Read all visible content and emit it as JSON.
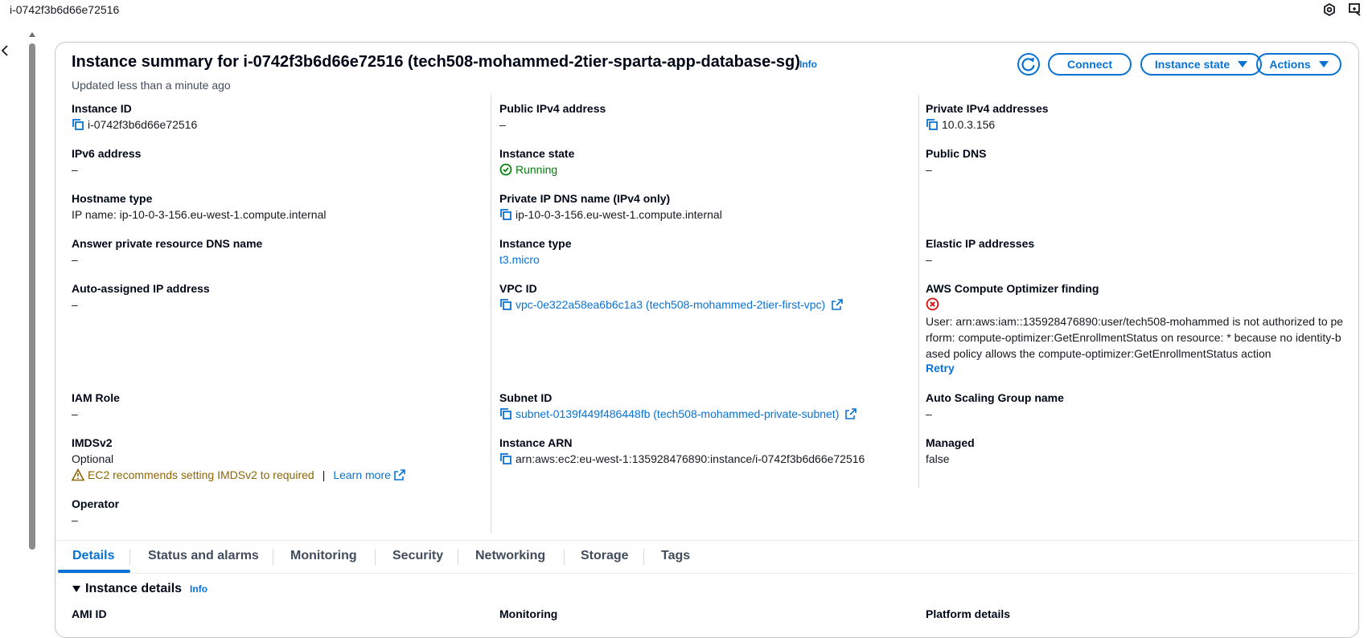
{
  "topbar": {
    "title": "i-0742f3b6d66e72516"
  },
  "summary": {
    "title": "Instance summary for i-0742f3b6d66e72516 (tech508-mohammed-2tier-sparta-app-database-sg)",
    "info": "Info",
    "updated": "Updated less than a minute ago",
    "buttons": {
      "connect": "Connect",
      "instance_state": "Instance state",
      "actions": "Actions"
    }
  },
  "fields": {
    "instance_id": {
      "label": "Instance ID",
      "value": "i-0742f3b6d66e72516"
    },
    "ipv6": {
      "label": "IPv6 address",
      "value": "–"
    },
    "hostname_type": {
      "label": "Hostname type",
      "value": "IP name: ip-10-0-3-156.eu-west-1.compute.internal"
    },
    "answer_dns": {
      "label": "Answer private resource DNS name",
      "value": "–"
    },
    "auto_ip": {
      "label": "Auto-assigned IP address",
      "value": "–"
    },
    "iam_role": {
      "label": "IAM Role",
      "value": "–"
    },
    "imdsv2": {
      "label": "IMDSv2",
      "value": "Optional",
      "warning": "EC2 recommends setting IMDSv2 to required",
      "learn_more": "Learn more"
    },
    "operator": {
      "label": "Operator",
      "value": "–"
    },
    "public_ipv4": {
      "label": "Public IPv4 address",
      "value": "–"
    },
    "instance_state": {
      "label": "Instance state",
      "value": "Running"
    },
    "private_ip_dns": {
      "label": "Private IP DNS name (IPv4 only)",
      "value": "ip-10-0-3-156.eu-west-1.compute.internal"
    },
    "instance_type": {
      "label": "Instance type",
      "value": "t3.micro"
    },
    "vpc_id": {
      "label": "VPC ID",
      "value": "vpc-0e322a58ea6b6c1a3 (tech508-mohammed-2tier-first-vpc)"
    },
    "subnet_id": {
      "label": "Subnet ID",
      "value": "subnet-0139f449f486448fb (tech508-mohammed-private-subnet)"
    },
    "instance_arn": {
      "label": "Instance ARN",
      "value": "arn:aws:ec2:eu-west-1:135928476890:instance/i-0742f3b6d66e72516"
    },
    "private_ipv4": {
      "label": "Private IPv4 addresses",
      "value": "10.0.3.156"
    },
    "public_dns": {
      "label": "Public DNS",
      "value": "–"
    },
    "elastic_ip": {
      "label": "Elastic IP addresses",
      "value": "–"
    },
    "compute_optimizer": {
      "label": "AWS Compute Optimizer finding",
      "message": "User: arn:aws:iam::135928476890:user/tech508-mohammed is not authorized to perform: compute-optimizer:GetEnrollmentStatus on resource: * because no identity-based policy allows the compute-optimizer:GetEnrollmentStatus action",
      "retry": "Retry"
    },
    "asg_name": {
      "label": "Auto Scaling Group name",
      "value": "–"
    },
    "managed": {
      "label": "Managed",
      "value": "false"
    }
  },
  "tabs": [
    "Details",
    "Status and alarms",
    "Monitoring",
    "Security",
    "Networking",
    "Storage",
    "Tags"
  ],
  "details_section": {
    "title": "Instance details",
    "info": "Info",
    "labels": {
      "ami_id": "AMI ID",
      "monitoring": "Monitoring",
      "platform": "Platform details"
    }
  },
  "colors": {
    "link": "#0972d3",
    "success": "#037f0c",
    "warning": "#8d6605",
    "error": "#d91515"
  }
}
